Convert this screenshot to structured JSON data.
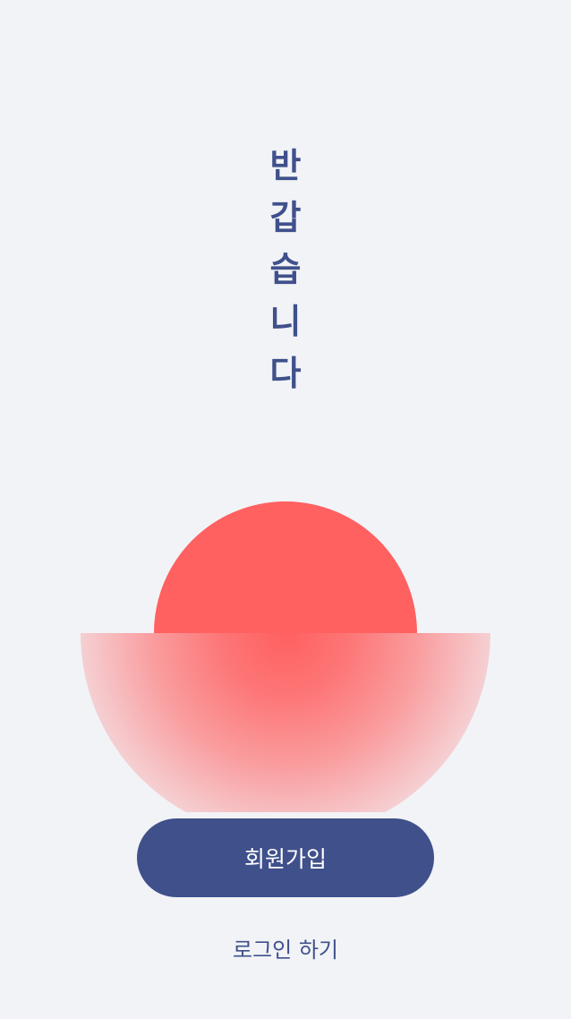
{
  "title": {
    "chars": [
      "반",
      "갑",
      "습",
      "니",
      "다"
    ]
  },
  "actions": {
    "signup_label": "회원가입",
    "login_label": "로그인 하기"
  },
  "colors": {
    "background": "#f2f3f7",
    "primary": "#3f508b",
    "sun": "#ff6060",
    "button_text": "#ffffff"
  },
  "illustration": {
    "icon": "sunset-icon"
  }
}
